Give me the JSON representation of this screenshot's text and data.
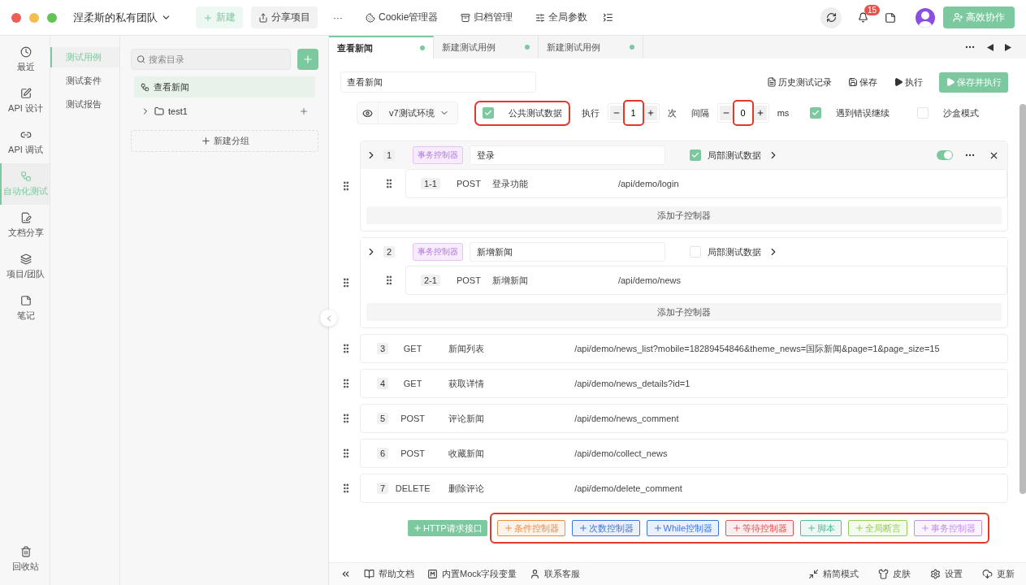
{
  "window": {
    "team": "涅柔斯的私有团队"
  },
  "toolbar": [
    {
      "kind": "new",
      "label": "新建"
    },
    {
      "kind": "share",
      "label": "分享项目"
    },
    {
      "kind": "more",
      "label": "···"
    },
    {
      "kind": "cookie",
      "label": "Cookie管理器"
    },
    {
      "kind": "archive",
      "label": "归档管理"
    },
    {
      "kind": "params",
      "label": "全局参数"
    }
  ],
  "header_right": {
    "notifications": "15",
    "collab_button": "高效协作"
  },
  "nav": [
    {
      "label": "最近",
      "selected": false
    },
    {
      "label": "API 设计",
      "selected": false
    },
    {
      "label": "API 调试",
      "selected": false
    },
    {
      "label": "自动化测试",
      "selected": true
    },
    {
      "label": "文档分享",
      "selected": false
    },
    {
      "label": "项目/团队",
      "selected": false
    },
    {
      "label": "笔记",
      "selected": false
    }
  ],
  "nav_bottom": {
    "label": "回收站"
  },
  "subnav": [
    {
      "label": "测试用例",
      "selected": true
    },
    {
      "label": "测试套件",
      "selected": false
    },
    {
      "label": "测试报告",
      "selected": false
    }
  ],
  "tree": {
    "search": {
      "placeholder": "搜索目录"
    },
    "items": [
      {
        "kind": "case",
        "label": "查看新闻",
        "selected": true
      },
      {
        "kind": "folder",
        "label": "test1",
        "selected": false,
        "expanded": false
      }
    ],
    "new_group": "新建分组"
  },
  "tabs": [
    {
      "label": "查看新闻",
      "selected": true
    },
    {
      "label": "新建测试用例",
      "selected": false
    },
    {
      "label": "新建测试用例",
      "selected": false
    }
  ],
  "case": {
    "name": "查看新闻",
    "actions": [
      {
        "kind": "history",
        "label": "历史测试记录"
      },
      {
        "kind": "save",
        "label": "保存"
      },
      {
        "kind": "run",
        "label": "执行"
      }
    ],
    "primary": "保存并执行"
  },
  "options": {
    "env": "v7测试环境",
    "public_data": {
      "label": "公共测试数据",
      "checked": true,
      "annotated": true
    },
    "repeat": {
      "label": "执行",
      "value": "1",
      "unit": "次",
      "annotated": true
    },
    "interval": {
      "label": "间隔",
      "value": "0",
      "unit": "ms",
      "annotated": true
    },
    "continue_on_error": {
      "label": "遇到错误继续",
      "checked": true
    },
    "sandbox": {
      "label": "沙盒模式",
      "checked": false
    }
  },
  "steps": [
    {
      "kind": "controller",
      "index": "1",
      "tag": "事务控制器",
      "name": "登录",
      "local_data": {
        "label": "局部测试数据",
        "checked": true
      },
      "toolbar": {
        "enabled": true
      },
      "children": [
        {
          "index": "1-1",
          "method": "POST",
          "name": "登录功能",
          "path": "/api/demo/login"
        }
      ],
      "add_child": "添加子控制器"
    },
    {
      "kind": "controller",
      "index": "2",
      "tag": "事务控制器",
      "name": "新增新闻",
      "local_data": {
        "label": "局部测试数据",
        "checked": false
      },
      "children": [
        {
          "index": "2-1",
          "method": "POST",
          "name": "新增新闻",
          "path": "/api/demo/news"
        }
      ],
      "add_child": "添加子控制器"
    },
    {
      "kind": "request",
      "index": "3",
      "method": "GET",
      "name": "新闻列表",
      "path": "/api/demo/news_list?mobile=18289454846&theme_news=国际新闻&page=1&page_size=15"
    },
    {
      "kind": "request",
      "index": "4",
      "method": "GET",
      "name": "获取详情",
      "path": "/api/demo/news_details?id=1"
    },
    {
      "kind": "request",
      "index": "5",
      "method": "POST",
      "name": "评论新闻",
      "path": "/api/demo/news_comment"
    },
    {
      "kind": "request",
      "index": "6",
      "method": "POST",
      "name": "收藏新闻",
      "path": "/api/demo/collect_news"
    },
    {
      "kind": "request",
      "index": "7",
      "method": "DELETE",
      "name": "删除评论",
      "path": "/api/demo/delete_comment"
    }
  ],
  "add_http": {
    "label": "HTTP请求接口"
  },
  "add_controllers": {
    "annotated": true,
    "items": [
      {
        "label": "条件控制器",
        "color": "#f08c3c"
      },
      {
        "label": "次数控制器",
        "color": "#3d76e0"
      },
      {
        "label": "While控制器",
        "color": "#3d76e0"
      },
      {
        "label": "等待控制器",
        "color": "#e05555"
      },
      {
        "label": "脚本",
        "color": "#4cbf98"
      },
      {
        "label": "全局断言",
        "color": "#94d050"
      },
      {
        "label": "事务控制器",
        "color": "#c590ea"
      }
    ]
  },
  "status_bar": {
    "left": [
      {
        "kind": "help",
        "label": "帮助文档"
      },
      {
        "kind": "mock",
        "label": "内置Mock字段变量"
      },
      {
        "kind": "contact",
        "label": "联系客服"
      }
    ],
    "right": [
      {
        "kind": "compact",
        "label": "精简模式"
      },
      {
        "kind": "skin",
        "label": "皮肤"
      },
      {
        "kind": "settings",
        "label": "设置"
      },
      {
        "kind": "update",
        "label": "更新"
      }
    ]
  }
}
